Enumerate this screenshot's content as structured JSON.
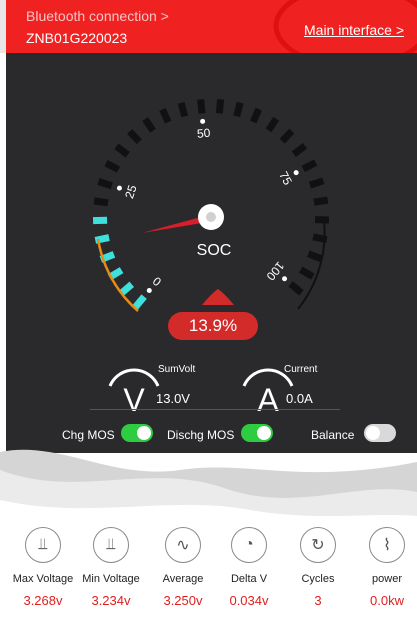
{
  "header": {
    "bt_link": "Bluetooth connection >",
    "device_id": "ZNB01G220023",
    "main_link": "Main interface >"
  },
  "gauge": {
    "center_label": "SOC",
    "tick_labels": [
      "0",
      "25",
      "50",
      "75",
      "100"
    ],
    "soc_percent": 13.9,
    "soc_text": "13.9%"
  },
  "metrics": {
    "sumvolt_label": "SumVolt",
    "sumvolt_value": "13.0V",
    "current_label": "Current",
    "current_value": "0.0A"
  },
  "toggles": {
    "chg_label": "Chg MOS",
    "dischg_label": "Dischg MOS",
    "balance_label": "Balance",
    "chg_on": true,
    "dischg_on": true,
    "balance_on": false
  },
  "colors": {
    "header_red": "#f02121",
    "accent_green": "#2ecc40",
    "accent_cyan": "#3de0dc",
    "value_red": "#e02020"
  },
  "stats": [
    {
      "icon": "voltage-max-icon",
      "label": "Max Voltage",
      "value": "3.268v"
    },
    {
      "icon": "voltage-min-icon",
      "label": "Min Voltage",
      "value": "3.234v"
    },
    {
      "icon": "sine-wave-icon",
      "label": "Average",
      "value": "3.250v"
    },
    {
      "icon": "gauge-icon",
      "label": "Delta V",
      "value": "0.034v"
    },
    {
      "icon": "cycle-icon",
      "label": "Cycles",
      "value": "3"
    },
    {
      "icon": "pulse-icon",
      "label": "power",
      "value": "0.0kw"
    }
  ]
}
